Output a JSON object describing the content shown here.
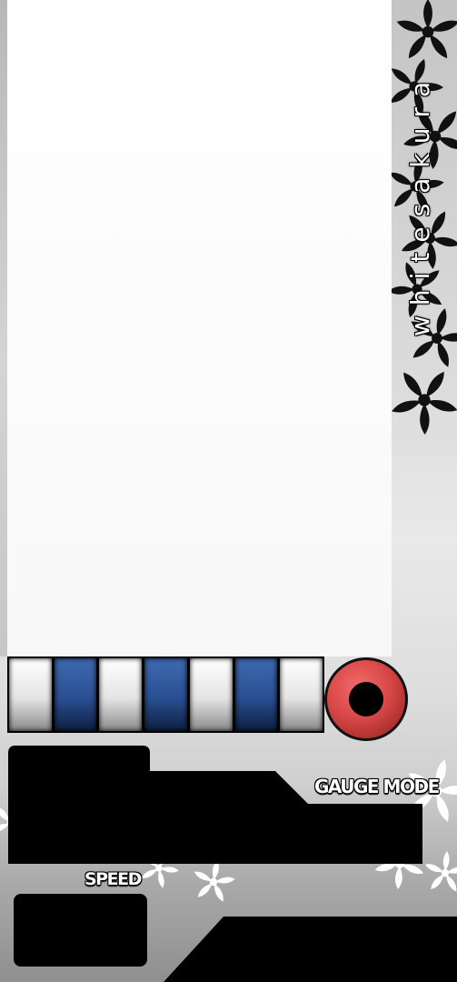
{
  "side_title": "whitesakura",
  "labels": {
    "gauge_mode": "GAUGE MODE",
    "speed": "SPEED"
  },
  "keys": [
    "white",
    "blue",
    "white",
    "blue",
    "white",
    "blue",
    "white"
  ],
  "icons": {
    "flower": "sakura-flower-icon",
    "turntable": "turntable-icon"
  },
  "colors": {
    "turntable": "#d94848",
    "blue_key": "#2a4f92",
    "panel": "#000000",
    "flower_dark": "#111111",
    "flower_light": "#ffffff"
  }
}
